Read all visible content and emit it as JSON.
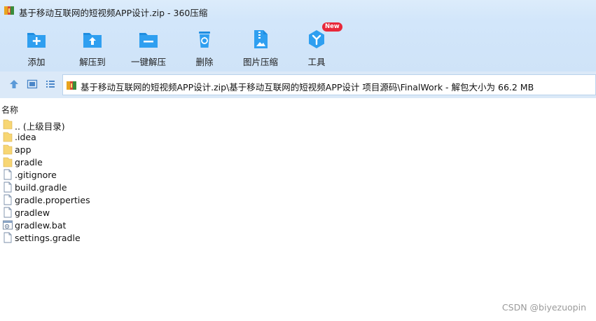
{
  "window": {
    "title": "基于移动互联网的短视频APP设计.zip - 360压缩"
  },
  "toolbar": {
    "items": [
      {
        "label": "添加",
        "icon": "add-icon"
      },
      {
        "label": "解压到",
        "icon": "extract-to-icon"
      },
      {
        "label": "一键解压",
        "icon": "one-click-extract-icon"
      },
      {
        "label": "删除",
        "icon": "delete-icon"
      },
      {
        "label": "图片压缩",
        "icon": "image-compress-icon"
      },
      {
        "label": "工具",
        "icon": "tools-icon",
        "badge": "New"
      }
    ]
  },
  "address": {
    "path": "基于移动互联网的短视频APP设计.zip\\基于移动互联网的短视频APP设计 项目源码\\FinalWork - 解包大小为 66.2 MB"
  },
  "columns": {
    "name": "名称"
  },
  "files": [
    {
      "name": ".. (上级目录)",
      "type": "folder"
    },
    {
      "name": ".idea",
      "type": "folder"
    },
    {
      "name": "app",
      "type": "folder"
    },
    {
      "name": "gradle",
      "type": "folder"
    },
    {
      "name": ".gitignore",
      "type": "file"
    },
    {
      "name": "build.gradle",
      "type": "file"
    },
    {
      "name": "gradle.properties",
      "type": "file"
    },
    {
      "name": "gradlew",
      "type": "file"
    },
    {
      "name": "gradlew.bat",
      "type": "bat"
    },
    {
      "name": "settings.gradle",
      "type": "file"
    }
  ],
  "watermark": "CSDN @biyezuopin",
  "colors": {
    "accent": "#1e8de0",
    "toolbar_bg": "#d2e6fa",
    "badge": "#e8283a"
  }
}
